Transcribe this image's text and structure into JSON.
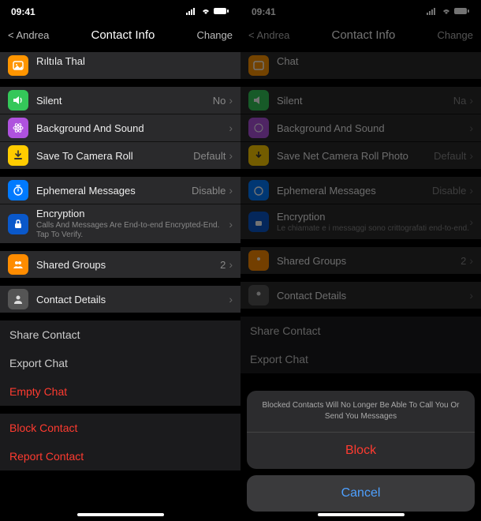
{
  "status": {
    "time": "09:41",
    "signal": ".ıl",
    "wifi": "wifi",
    "batt": "full"
  },
  "nav": {
    "back": "< Andrea",
    "title": "Contact Info",
    "change": "Change"
  },
  "left": {
    "rowTop": "Rıltıla Thal",
    "silent": {
      "label": "Silent",
      "value": "No"
    },
    "bg": "Background And Sound",
    "save": {
      "label": "Save To Camera Roll",
      "value": "Default"
    },
    "eph": {
      "label": "Ephemeral Messages",
      "value": "Disable"
    },
    "enc": {
      "label": "Encryption",
      "sub": "Calls And Messages Are End-to-end Encrypted-End. Tap To Verify."
    },
    "groups": {
      "label": "Shared Groups",
      "count": "2"
    },
    "details": "Contact Details",
    "share": "Share Contact",
    "export": "Export Chat",
    "empty": "Empty Chat",
    "block": "Block Contact",
    "report": "Report Contact"
  },
  "right": {
    "rowTop": "Chat",
    "silent": {
      "label": "Silent",
      "value": "Na"
    },
    "bg": "Background And Sound",
    "save": {
      "label": "Save Net Camera Roll Photo",
      "value": "Default"
    },
    "eph": {
      "label": "Ephemeral Messages",
      "value": "Disable"
    },
    "enc": {
      "label": "Encryption",
      "sub": "Le chiamate e i messaggi sono crittografati end-to-end."
    },
    "groups": {
      "label": "Shared Groups",
      "count": "2"
    },
    "details": "Contact Details",
    "share": "Share Contact",
    "export": "Export Chat"
  },
  "sheet": {
    "message": "Blocked Contacts Will No Longer Be Able To Call You Or Send You Messages",
    "block": "Block",
    "cancel": "Cancel"
  }
}
